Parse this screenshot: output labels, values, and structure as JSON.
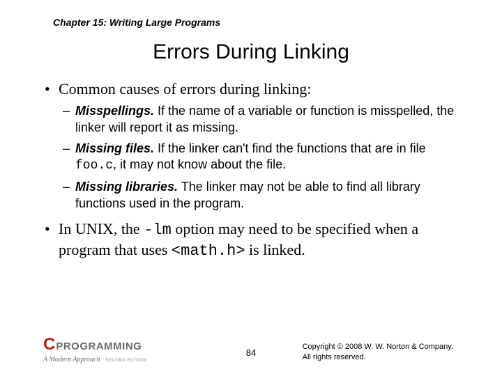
{
  "header": {
    "chapter": "Chapter 15: Writing Large Programs"
  },
  "title": "Errors During Linking",
  "bullets": [
    {
      "lead": "Common causes of errors during linking:",
      "sub": [
        {
          "term": "Misspellings.",
          "text": " If the name of a variable or function is misspelled, the linker will report it as missing."
        },
        {
          "term": "Missing files.",
          "text_a": " If the linker can't find the functions that are in file ",
          "code": "foo.c",
          "text_b": ", it may not know about the file."
        },
        {
          "term": "Missing libraries.",
          "text": " The linker may not be able to find all library functions used in the program."
        }
      ]
    },
    {
      "lead_a": "In UNIX, the ",
      "code1": "-lm",
      "lead_b": " option may need to be specified when a program that uses ",
      "code2": "<math.h>",
      "lead_c": " is linked."
    }
  ],
  "footer": {
    "logo_c": "C",
    "logo_prog": "PROGRAMMING",
    "logo_sub": "A Modern Approach",
    "logo_ed": "SECOND EDITION",
    "page": "84",
    "copy1": "Copyright © 2008 W. W. Norton & Company.",
    "copy2": "All rights reserved."
  }
}
